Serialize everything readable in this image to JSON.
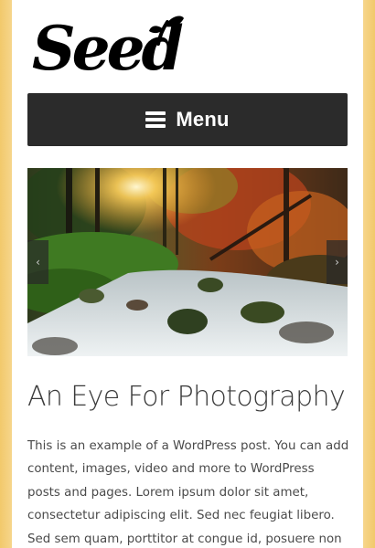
{
  "header": {
    "logo_text": "Seed"
  },
  "nav": {
    "menu_label": "Menu",
    "menu_icon": "hamburger-icon"
  },
  "slider": {
    "image_alt": "forest stream at sunset",
    "prev_label": "‹",
    "next_label": "›",
    "prev_icon": "chevron-left-icon",
    "next_icon": "chevron-right-icon"
  },
  "post": {
    "title": "An Eye For Photography",
    "excerpt": "This is an example of a WordPress post. You can add content, images, video and more to WordPress posts and pages. Lorem ipsum dolor sit amet, consectetur adipiscing elit. Sed nec feugiat libero. Sed sem quam, porttitor at congue id, posuere non"
  },
  "colors": {
    "menu_bar": "#2b2b2b",
    "text": "#4a4a4a",
    "title": "#3a3a3a",
    "side_gradient": "#f2c96b"
  }
}
